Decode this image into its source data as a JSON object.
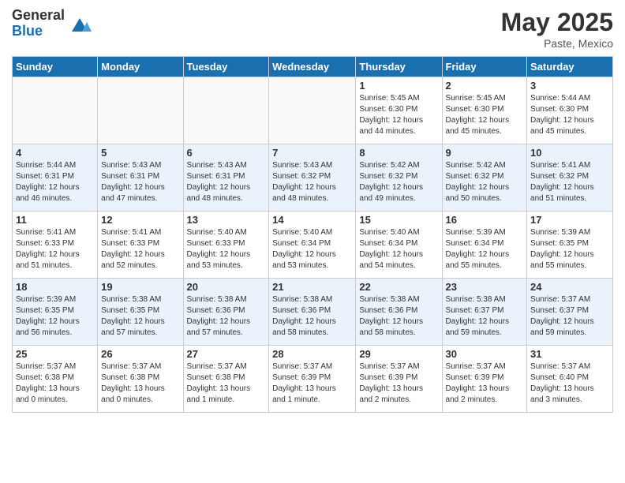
{
  "header": {
    "logo_general": "General",
    "logo_blue": "Blue",
    "month_title": "May 2025",
    "location": "Paste, Mexico"
  },
  "days_of_week": [
    "Sunday",
    "Monday",
    "Tuesday",
    "Wednesday",
    "Thursday",
    "Friday",
    "Saturday"
  ],
  "weeks": [
    [
      {
        "day": "",
        "info": ""
      },
      {
        "day": "",
        "info": ""
      },
      {
        "day": "",
        "info": ""
      },
      {
        "day": "",
        "info": ""
      },
      {
        "day": "1",
        "info": "Sunrise: 5:45 AM\nSunset: 6:30 PM\nDaylight: 12 hours\nand 44 minutes."
      },
      {
        "day": "2",
        "info": "Sunrise: 5:45 AM\nSunset: 6:30 PM\nDaylight: 12 hours\nand 45 minutes."
      },
      {
        "day": "3",
        "info": "Sunrise: 5:44 AM\nSunset: 6:30 PM\nDaylight: 12 hours\nand 45 minutes."
      }
    ],
    [
      {
        "day": "4",
        "info": "Sunrise: 5:44 AM\nSunset: 6:31 PM\nDaylight: 12 hours\nand 46 minutes."
      },
      {
        "day": "5",
        "info": "Sunrise: 5:43 AM\nSunset: 6:31 PM\nDaylight: 12 hours\nand 47 minutes."
      },
      {
        "day": "6",
        "info": "Sunrise: 5:43 AM\nSunset: 6:31 PM\nDaylight: 12 hours\nand 48 minutes."
      },
      {
        "day": "7",
        "info": "Sunrise: 5:43 AM\nSunset: 6:32 PM\nDaylight: 12 hours\nand 48 minutes."
      },
      {
        "day": "8",
        "info": "Sunrise: 5:42 AM\nSunset: 6:32 PM\nDaylight: 12 hours\nand 49 minutes."
      },
      {
        "day": "9",
        "info": "Sunrise: 5:42 AM\nSunset: 6:32 PM\nDaylight: 12 hours\nand 50 minutes."
      },
      {
        "day": "10",
        "info": "Sunrise: 5:41 AM\nSunset: 6:32 PM\nDaylight: 12 hours\nand 51 minutes."
      }
    ],
    [
      {
        "day": "11",
        "info": "Sunrise: 5:41 AM\nSunset: 6:33 PM\nDaylight: 12 hours\nand 51 minutes."
      },
      {
        "day": "12",
        "info": "Sunrise: 5:41 AM\nSunset: 6:33 PM\nDaylight: 12 hours\nand 52 minutes."
      },
      {
        "day": "13",
        "info": "Sunrise: 5:40 AM\nSunset: 6:33 PM\nDaylight: 12 hours\nand 53 minutes."
      },
      {
        "day": "14",
        "info": "Sunrise: 5:40 AM\nSunset: 6:34 PM\nDaylight: 12 hours\nand 53 minutes."
      },
      {
        "day": "15",
        "info": "Sunrise: 5:40 AM\nSunset: 6:34 PM\nDaylight: 12 hours\nand 54 minutes."
      },
      {
        "day": "16",
        "info": "Sunrise: 5:39 AM\nSunset: 6:34 PM\nDaylight: 12 hours\nand 55 minutes."
      },
      {
        "day": "17",
        "info": "Sunrise: 5:39 AM\nSunset: 6:35 PM\nDaylight: 12 hours\nand 55 minutes."
      }
    ],
    [
      {
        "day": "18",
        "info": "Sunrise: 5:39 AM\nSunset: 6:35 PM\nDaylight: 12 hours\nand 56 minutes."
      },
      {
        "day": "19",
        "info": "Sunrise: 5:38 AM\nSunset: 6:35 PM\nDaylight: 12 hours\nand 57 minutes."
      },
      {
        "day": "20",
        "info": "Sunrise: 5:38 AM\nSunset: 6:36 PM\nDaylight: 12 hours\nand 57 minutes."
      },
      {
        "day": "21",
        "info": "Sunrise: 5:38 AM\nSunset: 6:36 PM\nDaylight: 12 hours\nand 58 minutes."
      },
      {
        "day": "22",
        "info": "Sunrise: 5:38 AM\nSunset: 6:36 PM\nDaylight: 12 hours\nand 58 minutes."
      },
      {
        "day": "23",
        "info": "Sunrise: 5:38 AM\nSunset: 6:37 PM\nDaylight: 12 hours\nand 59 minutes."
      },
      {
        "day": "24",
        "info": "Sunrise: 5:37 AM\nSunset: 6:37 PM\nDaylight: 12 hours\nand 59 minutes."
      }
    ],
    [
      {
        "day": "25",
        "info": "Sunrise: 5:37 AM\nSunset: 6:38 PM\nDaylight: 13 hours\nand 0 minutes."
      },
      {
        "day": "26",
        "info": "Sunrise: 5:37 AM\nSunset: 6:38 PM\nDaylight: 13 hours\nand 0 minutes."
      },
      {
        "day": "27",
        "info": "Sunrise: 5:37 AM\nSunset: 6:38 PM\nDaylight: 13 hours\nand 1 minute."
      },
      {
        "day": "28",
        "info": "Sunrise: 5:37 AM\nSunset: 6:39 PM\nDaylight: 13 hours\nand 1 minute."
      },
      {
        "day": "29",
        "info": "Sunrise: 5:37 AM\nSunset: 6:39 PM\nDaylight: 13 hours\nand 2 minutes."
      },
      {
        "day": "30",
        "info": "Sunrise: 5:37 AM\nSunset: 6:39 PM\nDaylight: 13 hours\nand 2 minutes."
      },
      {
        "day": "31",
        "info": "Sunrise: 5:37 AM\nSunset: 6:40 PM\nDaylight: 13 hours\nand 3 minutes."
      }
    ]
  ]
}
